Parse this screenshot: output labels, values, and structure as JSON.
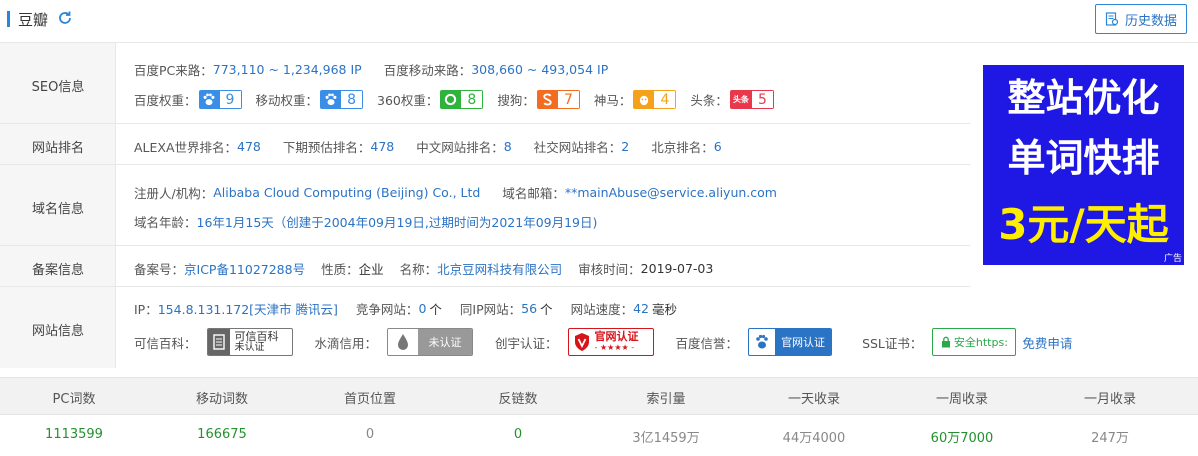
{
  "header": {
    "title": "豆瓣",
    "history_button": "历史数据"
  },
  "seo": {
    "label": "SEO信息",
    "pc_source_label": "百度PC来路：",
    "pc_source_value": "773,110 ~ 1,234,968 IP",
    "mobile_source_label": "百度移动来路：",
    "mobile_source_value": "308,660 ~ 493,054 IP",
    "weights": [
      {
        "label": "百度权重：",
        "value": "9",
        "icon": "paw-icon",
        "color": "#3a8ee6"
      },
      {
        "label": "移动权重：",
        "value": "8",
        "icon": "paw-icon",
        "color": "#3a8ee6"
      },
      {
        "label": "360权重：",
        "value": "8",
        "icon": "360-icon",
        "color": "#2fb33a"
      },
      {
        "label": "搜狗：",
        "value": "7",
        "icon": "sogou-icon",
        "color": "#f26d21"
      },
      {
        "label": "神马：",
        "value": "4",
        "icon": "shenma-icon",
        "color": "#f5a21a"
      },
      {
        "label": "头条：",
        "value": "5",
        "icon": "toutiao-icon",
        "color": "#e9384c",
        "icon_text": "头条"
      }
    ]
  },
  "rank": {
    "label": "网站排名",
    "items": [
      {
        "label": "ALEXA世界排名：",
        "value": "478"
      },
      {
        "label": "下期预估排名：",
        "value": "478"
      },
      {
        "label": "中文网站排名：",
        "value": "8"
      },
      {
        "label": "社交网站排名：",
        "value": "2"
      },
      {
        "label": "北京排名：",
        "value": "6"
      }
    ]
  },
  "domain": {
    "label": "域名信息",
    "registrant_label": "注册人/机构：",
    "registrant_value": "Alibaba Cloud Computing (Beijing) Co., Ltd",
    "email_label": "域名邮箱：",
    "email_value": "**mainAbuse@service.aliyun.com",
    "age_label": "域名年龄：",
    "age_value": "16年1月15天（创建于2004年09月19日,过期时间为2021年09月19日)"
  },
  "beian": {
    "label": "备案信息",
    "number_label": "备案号：",
    "number_value": "京ICP备11027288号",
    "type_label": "性质：",
    "type_value": "企业",
    "name_label": "名称：",
    "name_value": "北京豆网科技有限公司",
    "audit_label": "审核时间：",
    "audit_value": "2019-07-03"
  },
  "site": {
    "label": "网站信息",
    "ip_label": "IP：",
    "ip_value": "154.8.131.172[天津市 腾讯云]",
    "compete_label": "竞争网站：",
    "compete_value": "0",
    "compete_unit": "个",
    "sameip_label": "同IP网站：",
    "sameip_value": "56",
    "sameip_unit": "个",
    "speed_label": "网站速度：",
    "speed_value": "42",
    "speed_unit": "毫秒",
    "kexin_label": "可信百科：",
    "kexin_badge_1": "可信百科",
    "kexin_badge_2": "未认证",
    "shuidi_label": "水滴信用：",
    "shuidi_badge": "未认证",
    "chuangzi_label": "创宇认证：",
    "chuangzi_badge": "官网认证",
    "chuangzi_stars": "- ★★★★ -",
    "baidu_label": "百度信誉：",
    "baidu_badge": "官网认证",
    "ssl_label": "SSL证书：",
    "ssl_badge": "安全https:",
    "ssl_apply": "免费申请"
  },
  "ad": {
    "line1": "整站优化",
    "line2": "单词快排",
    "line3": "3元/天起",
    "tag": "广告"
  },
  "stats": {
    "columns": [
      "PC词数",
      "移动词数",
      "首页位置",
      "反链数",
      "索引量",
      "一天收录",
      "一周收录",
      "一月收录"
    ],
    "values": [
      "1113599",
      "166675",
      "0",
      "0",
      "3亿1459万",
      "44万4000",
      "60万7000",
      "247万"
    ],
    "value_colors": [
      "#24912f",
      "#24912f",
      "#888888",
      "#24912f",
      "#888888",
      "#888888",
      "#24912f",
      "#888888"
    ]
  }
}
